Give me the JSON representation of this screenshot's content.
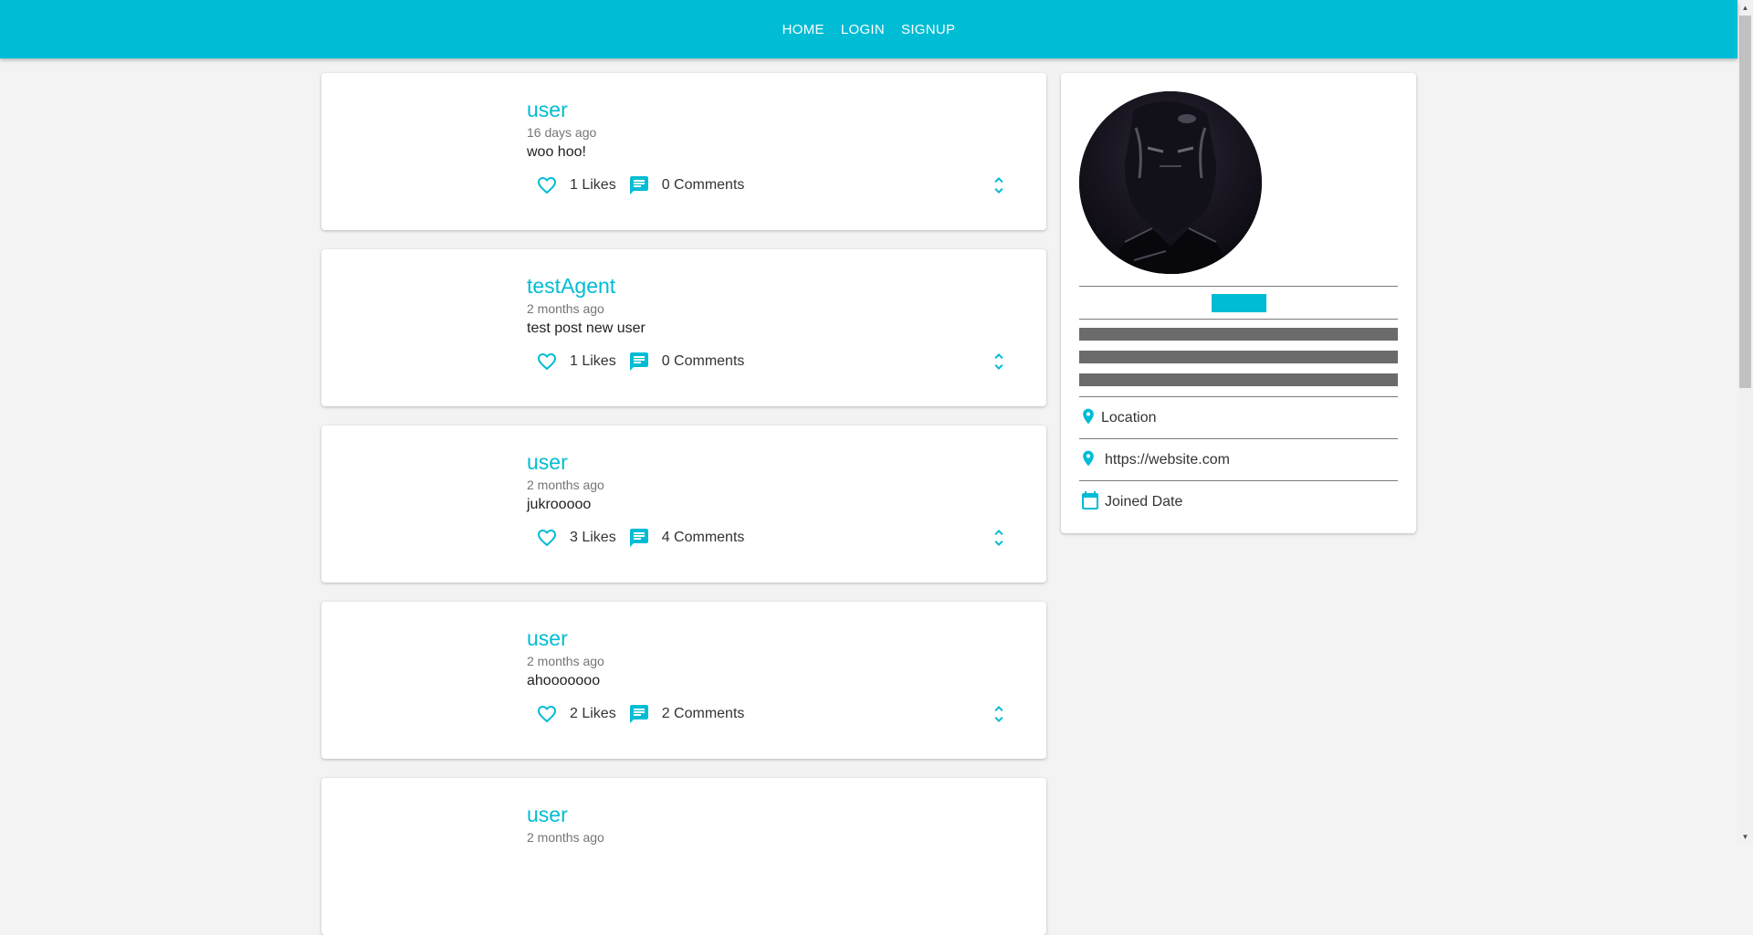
{
  "nav": {
    "links": [
      "HOME",
      "LOGIN",
      "SIGNUP"
    ]
  },
  "theme": {
    "accent": "#00bcd4",
    "background": "#f3f3f3"
  },
  "posts": [
    {
      "user": "user",
      "time": "16 days ago",
      "body": "woo hoo!",
      "likes": "1 Likes",
      "comments": "0 Comments"
    },
    {
      "user": "testAgent",
      "time": "2 months ago",
      "body": "test post new user",
      "likes": "1 Likes",
      "comments": "0 Comments"
    },
    {
      "user": "user",
      "time": "2 months ago",
      "body": "jukrooooo",
      "likes": "3 Likes",
      "comments": "4 Comments"
    },
    {
      "user": "user",
      "time": "2 months ago",
      "body": "ahooooooo",
      "likes": "2 Likes",
      "comments": "2 Comments"
    },
    {
      "user": "user",
      "time": "2 months ago",
      "body": "",
      "likes": "",
      "comments": ""
    }
  ],
  "profile": {
    "location": "Location",
    "website": "https://website.com",
    "joined": "Joined Date",
    "icons": {
      "location": "location-pin-icon",
      "website": "location-pin-icon",
      "joined": "calendar-icon"
    }
  },
  "icons": {
    "like": "heart-outline-icon",
    "comment": "chat-icon",
    "expand": "unfold-more-icon"
  }
}
